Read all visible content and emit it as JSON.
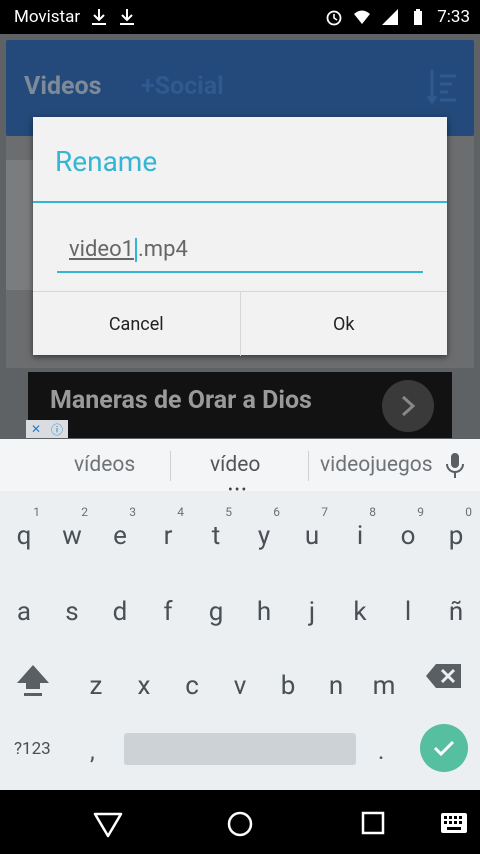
{
  "status_bar": {
    "carrier": "Movistar",
    "time": "7:33",
    "icons": [
      "download-icon",
      "download-icon",
      "alarm-icon",
      "wifi-icon",
      "signal-icon",
      "battery-icon"
    ]
  },
  "app": {
    "tabs": [
      "Videos",
      "+Social"
    ],
    "ad_text": "Maneras de Orar a Dios"
  },
  "dialog": {
    "title": "Rename",
    "input_selected": "video1",
    "input_rest": ".mp4",
    "cancel_label": "Cancel",
    "ok_label": "Ok"
  },
  "keyboard": {
    "suggestions": [
      "vídeos",
      "vídeo",
      "videojuegos"
    ],
    "row1": [
      {
        "ch": "q",
        "num": "1"
      },
      {
        "ch": "w",
        "num": "2"
      },
      {
        "ch": "e",
        "num": "3"
      },
      {
        "ch": "r",
        "num": "4"
      },
      {
        "ch": "t",
        "num": "5"
      },
      {
        "ch": "y",
        "num": "6"
      },
      {
        "ch": "u",
        "num": "7"
      },
      {
        "ch": "i",
        "num": "8"
      },
      {
        "ch": "o",
        "num": "9"
      },
      {
        "ch": "p",
        "num": "0"
      }
    ],
    "row2": [
      "a",
      "s",
      "d",
      "f",
      "g",
      "h",
      "j",
      "k",
      "l",
      "ñ"
    ],
    "row3": [
      "z",
      "x",
      "c",
      "v",
      "b",
      "n",
      "m"
    ],
    "symbols_label": "?123",
    "comma": ",",
    "period": "."
  },
  "colors": {
    "accent": "#33b5d6",
    "appbar": "#234a7a",
    "enter_key": "#55bfa0"
  }
}
